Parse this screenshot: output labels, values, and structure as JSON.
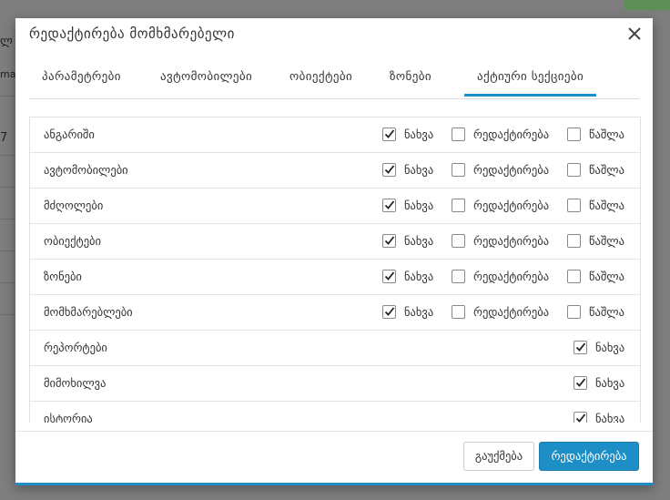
{
  "background": {
    "fragments": [
      "ლ",
      "mai",
      "7"
    ]
  },
  "modal": {
    "title": "რედაქტირება მომხმარებელი",
    "close_icon": "close-icon",
    "tabs": [
      {
        "label": "პარამეტრები",
        "active": false
      },
      {
        "label": "ავტომობილები",
        "active": false
      },
      {
        "label": "ობიექტები",
        "active": false
      },
      {
        "label": "ზონები",
        "active": false
      },
      {
        "label": "აქტიური სექციები",
        "active": true
      }
    ],
    "permissions": {
      "view_label": "ნახვა",
      "edit_label": "რედაქტირება",
      "delete_label": "წაშლა"
    },
    "rows": [
      {
        "label": "ანგარიში",
        "view": true,
        "edit": false,
        "delete": false
      },
      {
        "label": "ავტომობილები",
        "view": true,
        "edit": false,
        "delete": false
      },
      {
        "label": "მძღოლები",
        "view": true,
        "edit": false,
        "delete": false
      },
      {
        "label": "ობიექტები",
        "view": true,
        "edit": false,
        "delete": false
      },
      {
        "label": "ზონები",
        "view": true,
        "edit": false,
        "delete": false
      },
      {
        "label": "მომხმარებლები",
        "view": true,
        "edit": false,
        "delete": false
      },
      {
        "label": "რეპორტები",
        "view": true
      },
      {
        "label": "მიმოხილვა",
        "view": true
      },
      {
        "label": "ისტორია",
        "view": true
      }
    ],
    "footer": {
      "cancel_label": "გაუქმება",
      "submit_label": "რედაქტირება"
    },
    "colors": {
      "accent": "#1e8fc6",
      "overlay": "#7e7e7e"
    }
  }
}
